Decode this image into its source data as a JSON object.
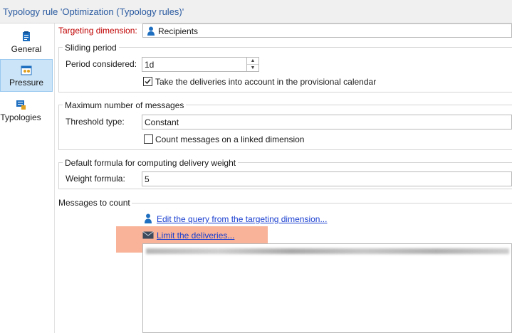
{
  "window": {
    "title": "Typology rule 'Optimization (Typology rules)'"
  },
  "sidebar": {
    "items": [
      {
        "label": "General",
        "icon": "clipboard-icon",
        "active": false
      },
      {
        "label": "Pressure",
        "icon": "calendar-people-icon",
        "active": true
      },
      {
        "label": "Typologies",
        "icon": "typologies-icon",
        "active": false
      }
    ]
  },
  "targeting": {
    "label": "Targeting dimension:",
    "value": "Recipients"
  },
  "sliding_period": {
    "legend": "Sliding period",
    "period_label": "Period considered:",
    "period_value": "1d",
    "calendar_checkbox_label": "Take the deliveries into account in the provisional calendar",
    "calendar_checkbox_checked": true
  },
  "max_messages": {
    "legend": "Maximum number of messages",
    "threshold_label": "Threshold type:",
    "threshold_value": "Constant",
    "linked_checkbox_label": "Count messages on a linked dimension",
    "linked_checkbox_checked": false
  },
  "weight": {
    "legend": "Default formula for computing delivery weight",
    "formula_label": "Weight formula:",
    "formula_value": "5"
  },
  "messages_to_count": {
    "heading": "Messages to count",
    "edit_query_link": "Edit the query from the targeting dimension...",
    "limit_link": "Limit the deliveries..."
  },
  "colors": {
    "accent": "#2a5aa0",
    "required": "#c00000",
    "link": "#1a3fd0",
    "highlight": "#f7ab8d"
  }
}
